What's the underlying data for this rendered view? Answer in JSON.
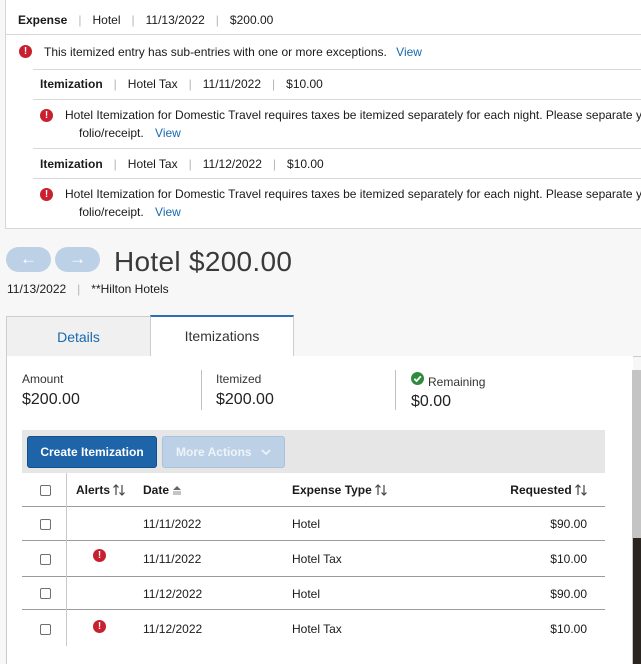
{
  "exceptions": {
    "header": {
      "type": "Expense",
      "name": "Hotel",
      "date": "11/13/2022",
      "amount": "$200.00"
    },
    "summary_message": "This itemized entry has sub-entries with one or more exceptions.",
    "view_label": "View",
    "items": [
      {
        "type": "Itemization",
        "name": "Hotel Tax",
        "date": "11/11/2022",
        "amount": "$10.00",
        "message_line1": "Hotel Itemization for Domestic Travel requires taxes be itemized separately for each night. Please separate your",
        "message_line2": "folio/receipt.",
        "view_label": "View"
      },
      {
        "type": "Itemization",
        "name": "Hotel Tax",
        "date": "11/12/2022",
        "amount": "$10.00",
        "message_line1": "Hotel Itemization for Domestic Travel requires taxes be itemized separately for each night. Please separate your",
        "message_line2": "folio/receipt.",
        "view_label": "View"
      }
    ]
  },
  "nav": {
    "prev_icon": "←",
    "next_icon": "→"
  },
  "expense": {
    "title": "Hotel $200.00",
    "date": "11/13/2022",
    "vendor": "**Hilton Hotels"
  },
  "tabs": {
    "details": "Details",
    "itemizations": "Itemizations"
  },
  "summary": {
    "amount_label": "Amount",
    "amount_value": "$200.00",
    "itemized_label": "Itemized",
    "itemized_value": "$200.00",
    "remaining_label": "Remaining",
    "remaining_value": "$0.00"
  },
  "toolbar": {
    "create_label": "Create Itemization",
    "more_actions_label": "More Actions"
  },
  "table": {
    "headers": {
      "alerts": "Alerts",
      "date": "Date",
      "expense_type": "Expense Type",
      "requested": "Requested"
    },
    "rows": [
      {
        "alert": false,
        "date": "11/11/2022",
        "expense_type": "Hotel",
        "requested": "$90.00"
      },
      {
        "alert": true,
        "date": "11/11/2022",
        "expense_type": "Hotel Tax",
        "requested": "$10.00"
      },
      {
        "alert": false,
        "date": "11/12/2022",
        "expense_type": "Hotel",
        "requested": "$90.00"
      },
      {
        "alert": true,
        "date": "11/12/2022",
        "expense_type": "Hotel Tax",
        "requested": "$10.00"
      }
    ]
  },
  "colors": {
    "accent": "#1d64a8",
    "alert": "#c8202e",
    "ok": "#2e8b3e",
    "link": "#1769b0"
  }
}
